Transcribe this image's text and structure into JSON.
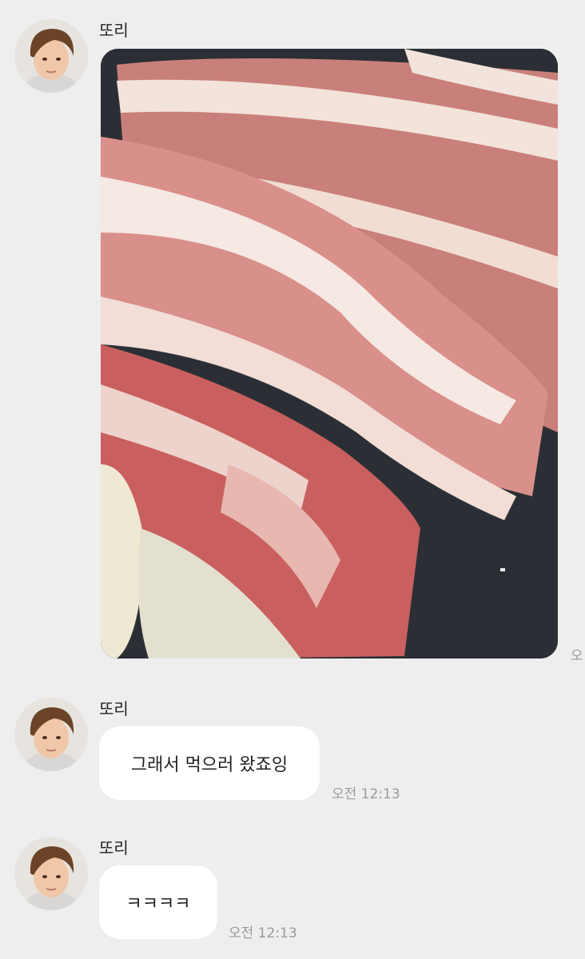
{
  "messages": [
    {
      "sender": "또리",
      "kind": "photo",
      "time": "오"
    },
    {
      "sender": "또리",
      "kind": "text",
      "text": "그래서 먹으러 왔죠잉",
      "time": "오전 12:13"
    },
    {
      "sender": "또리",
      "kind": "text",
      "text": "ㅋㅋㅋㅋ",
      "time": "오전 12:13"
    }
  ],
  "colors": {
    "background": "#eeeeef",
    "bubble": "#ffffff",
    "timestamp": "#9a9a9a"
  },
  "icons": {
    "avatar": "profile-photo"
  }
}
